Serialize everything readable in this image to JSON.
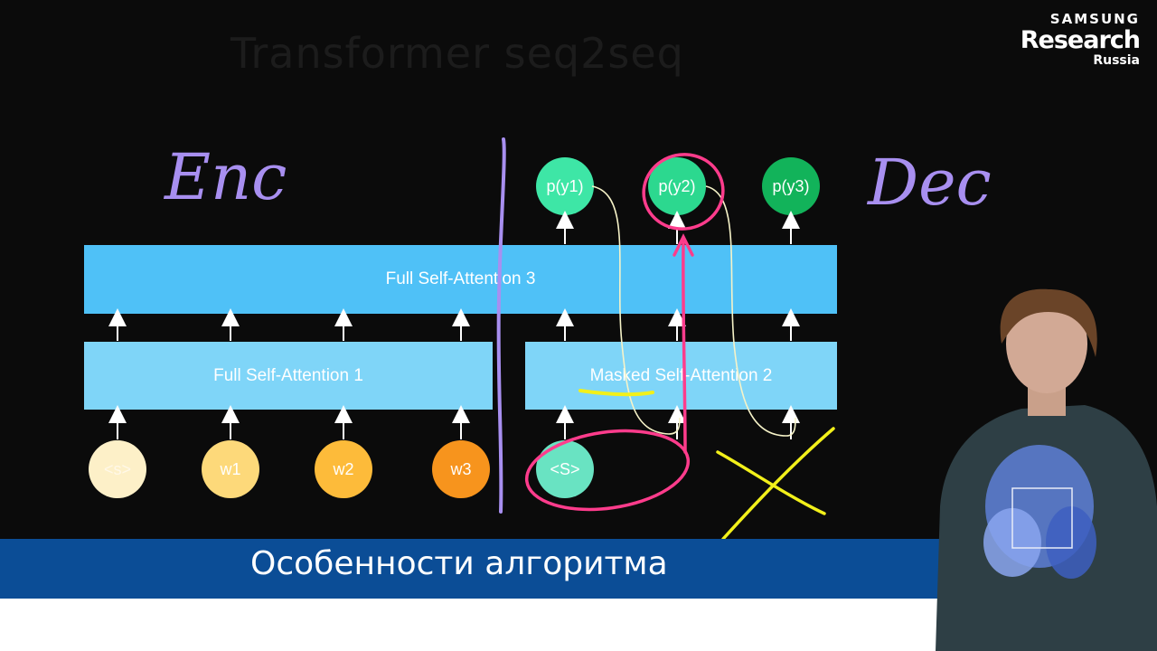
{
  "slide": {
    "faded_title": "Transformer seq2seq",
    "subtitle": "Особенности алгоритма"
  },
  "logo": {
    "line1": "SAMSUNG",
    "line2": "Research",
    "line3": "Russia"
  },
  "handwriting": {
    "encoder": "Enc",
    "decoder": "Dec"
  },
  "diagram": {
    "top_block": "Full Self-Attention 3",
    "encoder_block": "Full Self-Attention 1",
    "decoder_block": "Masked Self-Attention 2",
    "encoder_inputs": [
      "<s>",
      "w1",
      "w2",
      "w3"
    ],
    "decoder_input": "<S>",
    "outputs": [
      "p(y1)",
      "p(y2)",
      "p(y3)"
    ]
  },
  "colors": {
    "top_block": "#4fc1f7",
    "lower_blocks": "#7fd5f8",
    "input_nodes": [
      "#fdf0c8",
      "#fdd97a",
      "#fdbb3a",
      "#f7941d"
    ],
    "decoder_input_node": "#69e3c2",
    "output_nodes": [
      "#3ee6a6",
      "#2cd88f",
      "#12b35a"
    ],
    "purple_ink": "#a88ff0",
    "pink_ink": "#ff3c8c",
    "yellow_ink": "#f2f01a",
    "subtitle_band": "#0b4d96"
  }
}
